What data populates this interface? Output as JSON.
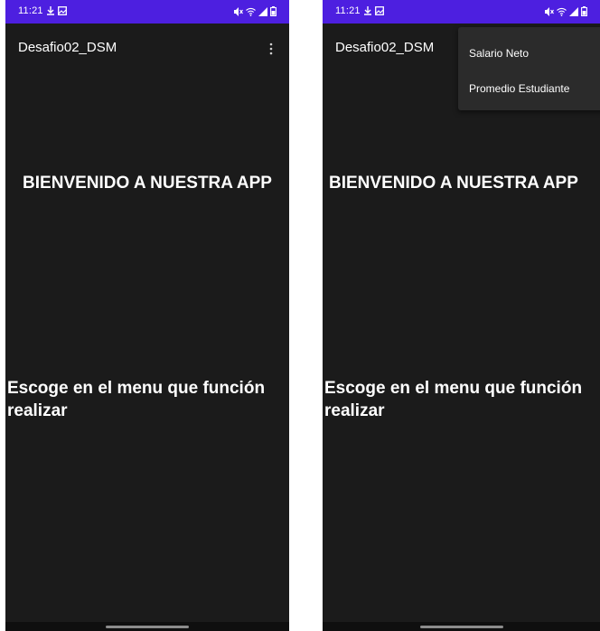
{
  "status_bar": {
    "time": "11:21"
  },
  "app": {
    "title": "Desafio02_DSM"
  },
  "content": {
    "welcome": "BIENVENIDO A NUESTRA APP",
    "instruction": "Escoge en el menu que función realizar"
  },
  "menu": {
    "items": [
      {
        "label": "Salario Neto"
      },
      {
        "label": "Promedio Estudiante"
      }
    ]
  },
  "icons": {
    "status_left": [
      "download-icon",
      "gallery-icon"
    ],
    "status_right": [
      "mute-icon",
      "wifi-icon",
      "signal-icon",
      "battery-icon"
    ],
    "overflow": "more-vert-icon"
  },
  "colors": {
    "status_bar": "#4d1fe0",
    "background": "#1b1b1b",
    "menu_background": "#2b2b2b",
    "text": "#ffffff"
  }
}
